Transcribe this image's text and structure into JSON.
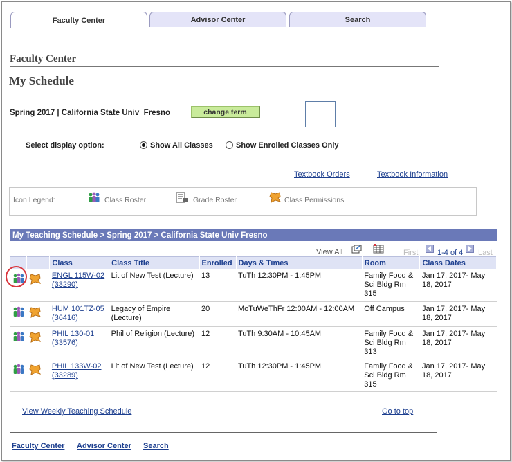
{
  "tabs": [
    {
      "label": "Faculty Center",
      "active": true
    },
    {
      "label": "Advisor Center",
      "active": false
    },
    {
      "label": "Search",
      "active": false
    }
  ],
  "section_title": "Faculty Center",
  "page_title": "My Schedule",
  "term": {
    "text": "Spring 2017 | California State Univ  Fresno",
    "change_label": "change term"
  },
  "display": {
    "label": "Select display option:",
    "options": [
      {
        "label": "Show All Classes",
        "selected": true
      },
      {
        "label": "Show Enrolled Classes Only",
        "selected": false
      }
    ]
  },
  "links": {
    "textbook_orders": "Textbook Orders",
    "textbook_information": "Textbook Information"
  },
  "legend": {
    "label": "Icon Legend:",
    "items": [
      {
        "icon": "class-roster-icon",
        "label": "Class Roster"
      },
      {
        "icon": "grade-roster-icon",
        "label": "Grade Roster"
      },
      {
        "icon": "class-permissions-icon",
        "label": "Class Permissions"
      }
    ]
  },
  "grid": {
    "title": "My Teaching Schedule > Spring 2017 > California State Univ Fresno",
    "view_all": "View All",
    "first": "First",
    "range": "1-4 of 4",
    "last": "Last",
    "columns": [
      "Class",
      "Class Title",
      "Enrolled",
      "Days & Times",
      "Room",
      "Class Dates"
    ],
    "rows": [
      {
        "class": "ENGL 115W-02",
        "class_nbr": "(33290)",
        "title": "Lit of New Test (Lecture)",
        "enrolled": "13",
        "days_times": "TuTh 12:30PM - 1:45PM",
        "room": "Family Food & Sci Bldg Rm 315",
        "dates": "Jan 17, 2017- May 18, 2017"
      },
      {
        "class": "HUM 101TZ-05",
        "class_nbr": "(36416)",
        "title": "Legacy of Empire (Lecture)",
        "enrolled": "20",
        "days_times": "MoTuWeThFr 12:00AM - 12:00AM",
        "room": "Off Campus",
        "dates": "Jan 17, 2017- May 18, 2017"
      },
      {
        "class": "PHIL 130-01",
        "class_nbr": "(33576)",
        "title": "Phil of Religion (Lecture)",
        "enrolled": "12",
        "days_times": "TuTh 9:30AM - 10:45AM",
        "room": "Family Food & Sci Bldg Rm 313",
        "dates": "Jan 17, 2017- May 18, 2017"
      },
      {
        "class": "PHIL 133W-02",
        "class_nbr": "(33289)",
        "title": "Lit of New Test (Lecture)",
        "enrolled": "12",
        "days_times": "TuTh 12:30PM - 1:45PM",
        "room": "Family Food & Sci Bldg Rm 315",
        "dates": "Jan 17, 2017- May 18, 2017"
      }
    ]
  },
  "bottom_links": {
    "weekly_schedule": "View Weekly Teaching Schedule",
    "go_to_top": "Go to top"
  },
  "footer": [
    "Faculty Center",
    "Advisor Center",
    "Search"
  ],
  "colors": {
    "grid_header": "#6a79b8",
    "tab_inactive": "#e4e4f8",
    "change_term_button": "#c9eb9b",
    "highlight_ring": "#d9363e"
  }
}
